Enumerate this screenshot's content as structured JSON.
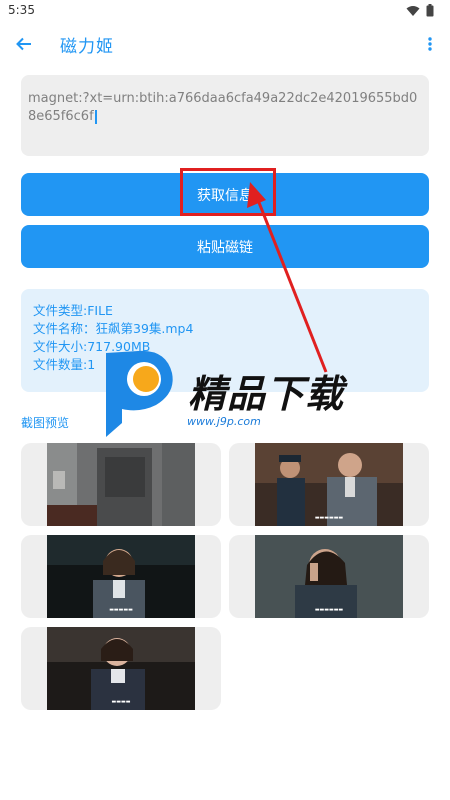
{
  "status_bar": {
    "time": "5:35"
  },
  "app_bar": {
    "title": "磁力姬"
  },
  "magnet": {
    "value": "magnet:?xt=urn:btih:a766daa6cfa49a22dc2e42019655bd08e65f6c6f"
  },
  "buttons": {
    "get_info": "获取信息",
    "paste_magnet": "粘贴磁链"
  },
  "info": {
    "file_type": "文件类型:FILE",
    "file_name": "文件名称：狂飙第39集.mp4",
    "file_size": "文件大小:717.90MB",
    "file_count": "文件数量:1"
  },
  "preview": {
    "label": "截图预览"
  },
  "watermark": {
    "brand": "精品下载",
    "url": "www.j9p.com"
  },
  "colors": {
    "accent": "#2196F3",
    "info_bg": "#e3f1fc",
    "input_bg": "#eeeeee",
    "annotation": "#e02020"
  }
}
